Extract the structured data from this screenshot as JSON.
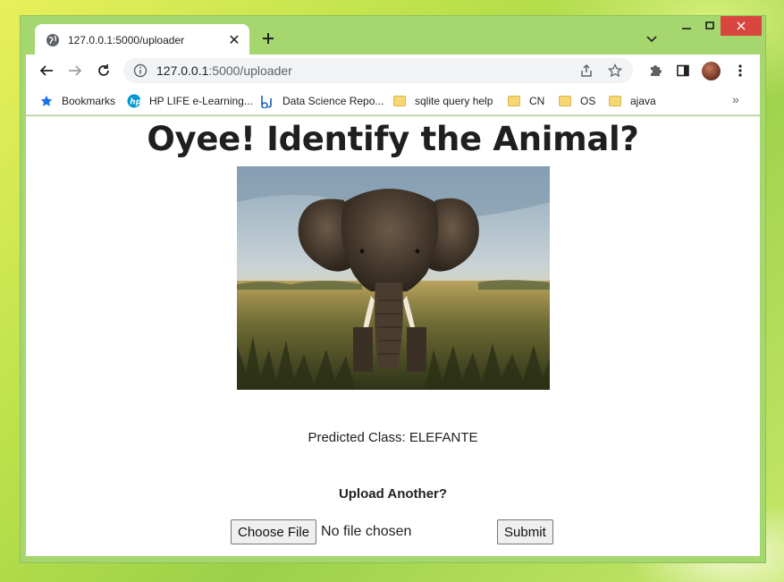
{
  "browser": {
    "tab_title": "127.0.0.1:5000/uploader",
    "url_host": "127.0.0.1",
    "url_rest": ":5000/uploader",
    "bookmarks": [
      {
        "label": "Bookmarks",
        "icon": "star-icon"
      },
      {
        "label": "HP LIFE e-Learning...",
        "icon": "hp-icon"
      },
      {
        "label": "Data Science Repo...",
        "icon": "dsr-icon"
      },
      {
        "label": "sqlite query help",
        "icon": "folder-icon"
      },
      {
        "label": "CN",
        "icon": "folder-icon"
      },
      {
        "label": "OS",
        "icon": "folder-icon"
      },
      {
        "label": "ajava",
        "icon": "folder-icon"
      }
    ]
  },
  "page": {
    "heading": "Oyee! Identify the Animal?",
    "image_alt": "elephant-photo",
    "predicted_text": "Predicted Class: ELEFANTE",
    "upload_again": "Upload Another?",
    "choose_file_label": "Choose File",
    "no_file_text": "No file chosen",
    "submit_label": "Submit"
  },
  "colors": {
    "window_frame": "#a5d76e",
    "close_button": "#d9453f"
  }
}
